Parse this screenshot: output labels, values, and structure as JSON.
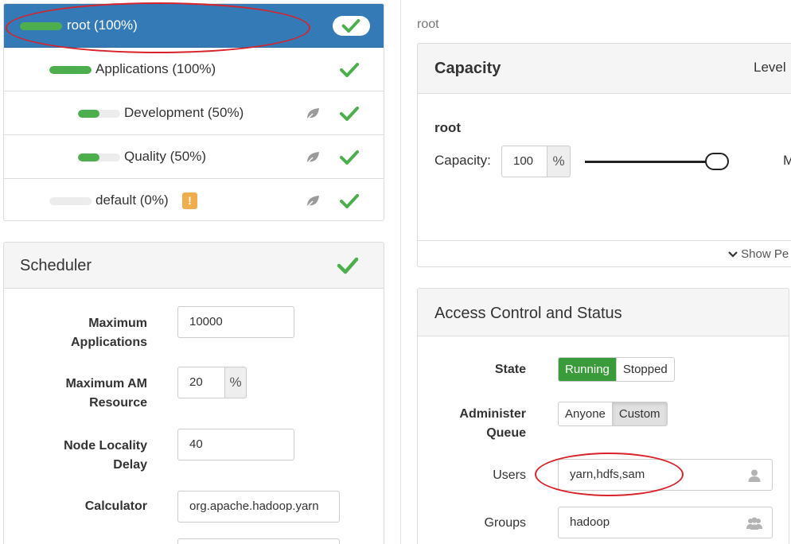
{
  "tree": {
    "queues": [
      {
        "label": "root (100%)",
        "fill": 1.0,
        "active": true,
        "leaf": false,
        "warning": false
      },
      {
        "label": "Applications (100%)",
        "fill": 1.0,
        "active": false,
        "leaf": false,
        "warning": false
      },
      {
        "label": "Development (50%)",
        "fill": 0.5,
        "active": false,
        "leaf": true,
        "warning": false
      },
      {
        "label": "Quality (50%)",
        "fill": 0.5,
        "active": false,
        "leaf": true,
        "warning": false
      },
      {
        "label": "default (0%)",
        "fill": 0.0,
        "active": false,
        "leaf": true,
        "warning": true
      }
    ],
    "warning_glyph": "!"
  },
  "scheduler": {
    "title": "Scheduler",
    "fields": [
      {
        "label": "Maximum Applications",
        "value": "10000",
        "addon": ""
      },
      {
        "label": "Maximum AM Resource",
        "value": "20",
        "addon": "%"
      },
      {
        "label": "Node Locality Delay",
        "value": "40",
        "addon": ""
      },
      {
        "label": "Calculator",
        "value": "org.apache.hadoop.yarn",
        "addon": ""
      }
    ]
  },
  "breadcrumb": "root",
  "capacity": {
    "title": "Capacity",
    "level_label": "Level",
    "queue_name": "root",
    "capacity_label": "Capacity:",
    "capacity_value": "100",
    "capacity_unit": "%",
    "slider_value": 100,
    "max_label_partial": "M",
    "show_label": "Show Pe"
  },
  "access": {
    "title": "Access Control and Status",
    "state_label": "State",
    "state_options": [
      "Running",
      "Stopped"
    ],
    "state_selected": "Running",
    "admin_label": "Administer Queue",
    "admin_options": [
      "Anyone",
      "Custom"
    ],
    "admin_selected": "Custom",
    "users_label": "Users",
    "users_value": "yarn,hdfs,sam",
    "groups_label": "Groups",
    "groups_value": "hadoop"
  },
  "colors": {
    "active_row": "#337ab7",
    "progress": "#4cae4c",
    "check": "#4cae4c",
    "warning": "#f0ad4e",
    "success_button": "#3a9b3a",
    "annotation": "#d9222a"
  },
  "icons": {
    "check": "check-icon",
    "leaf": "leaf-icon",
    "warning": "warning-icon",
    "chevron": "chevron-down-icon",
    "user": "user-icon",
    "group": "users-icon"
  }
}
